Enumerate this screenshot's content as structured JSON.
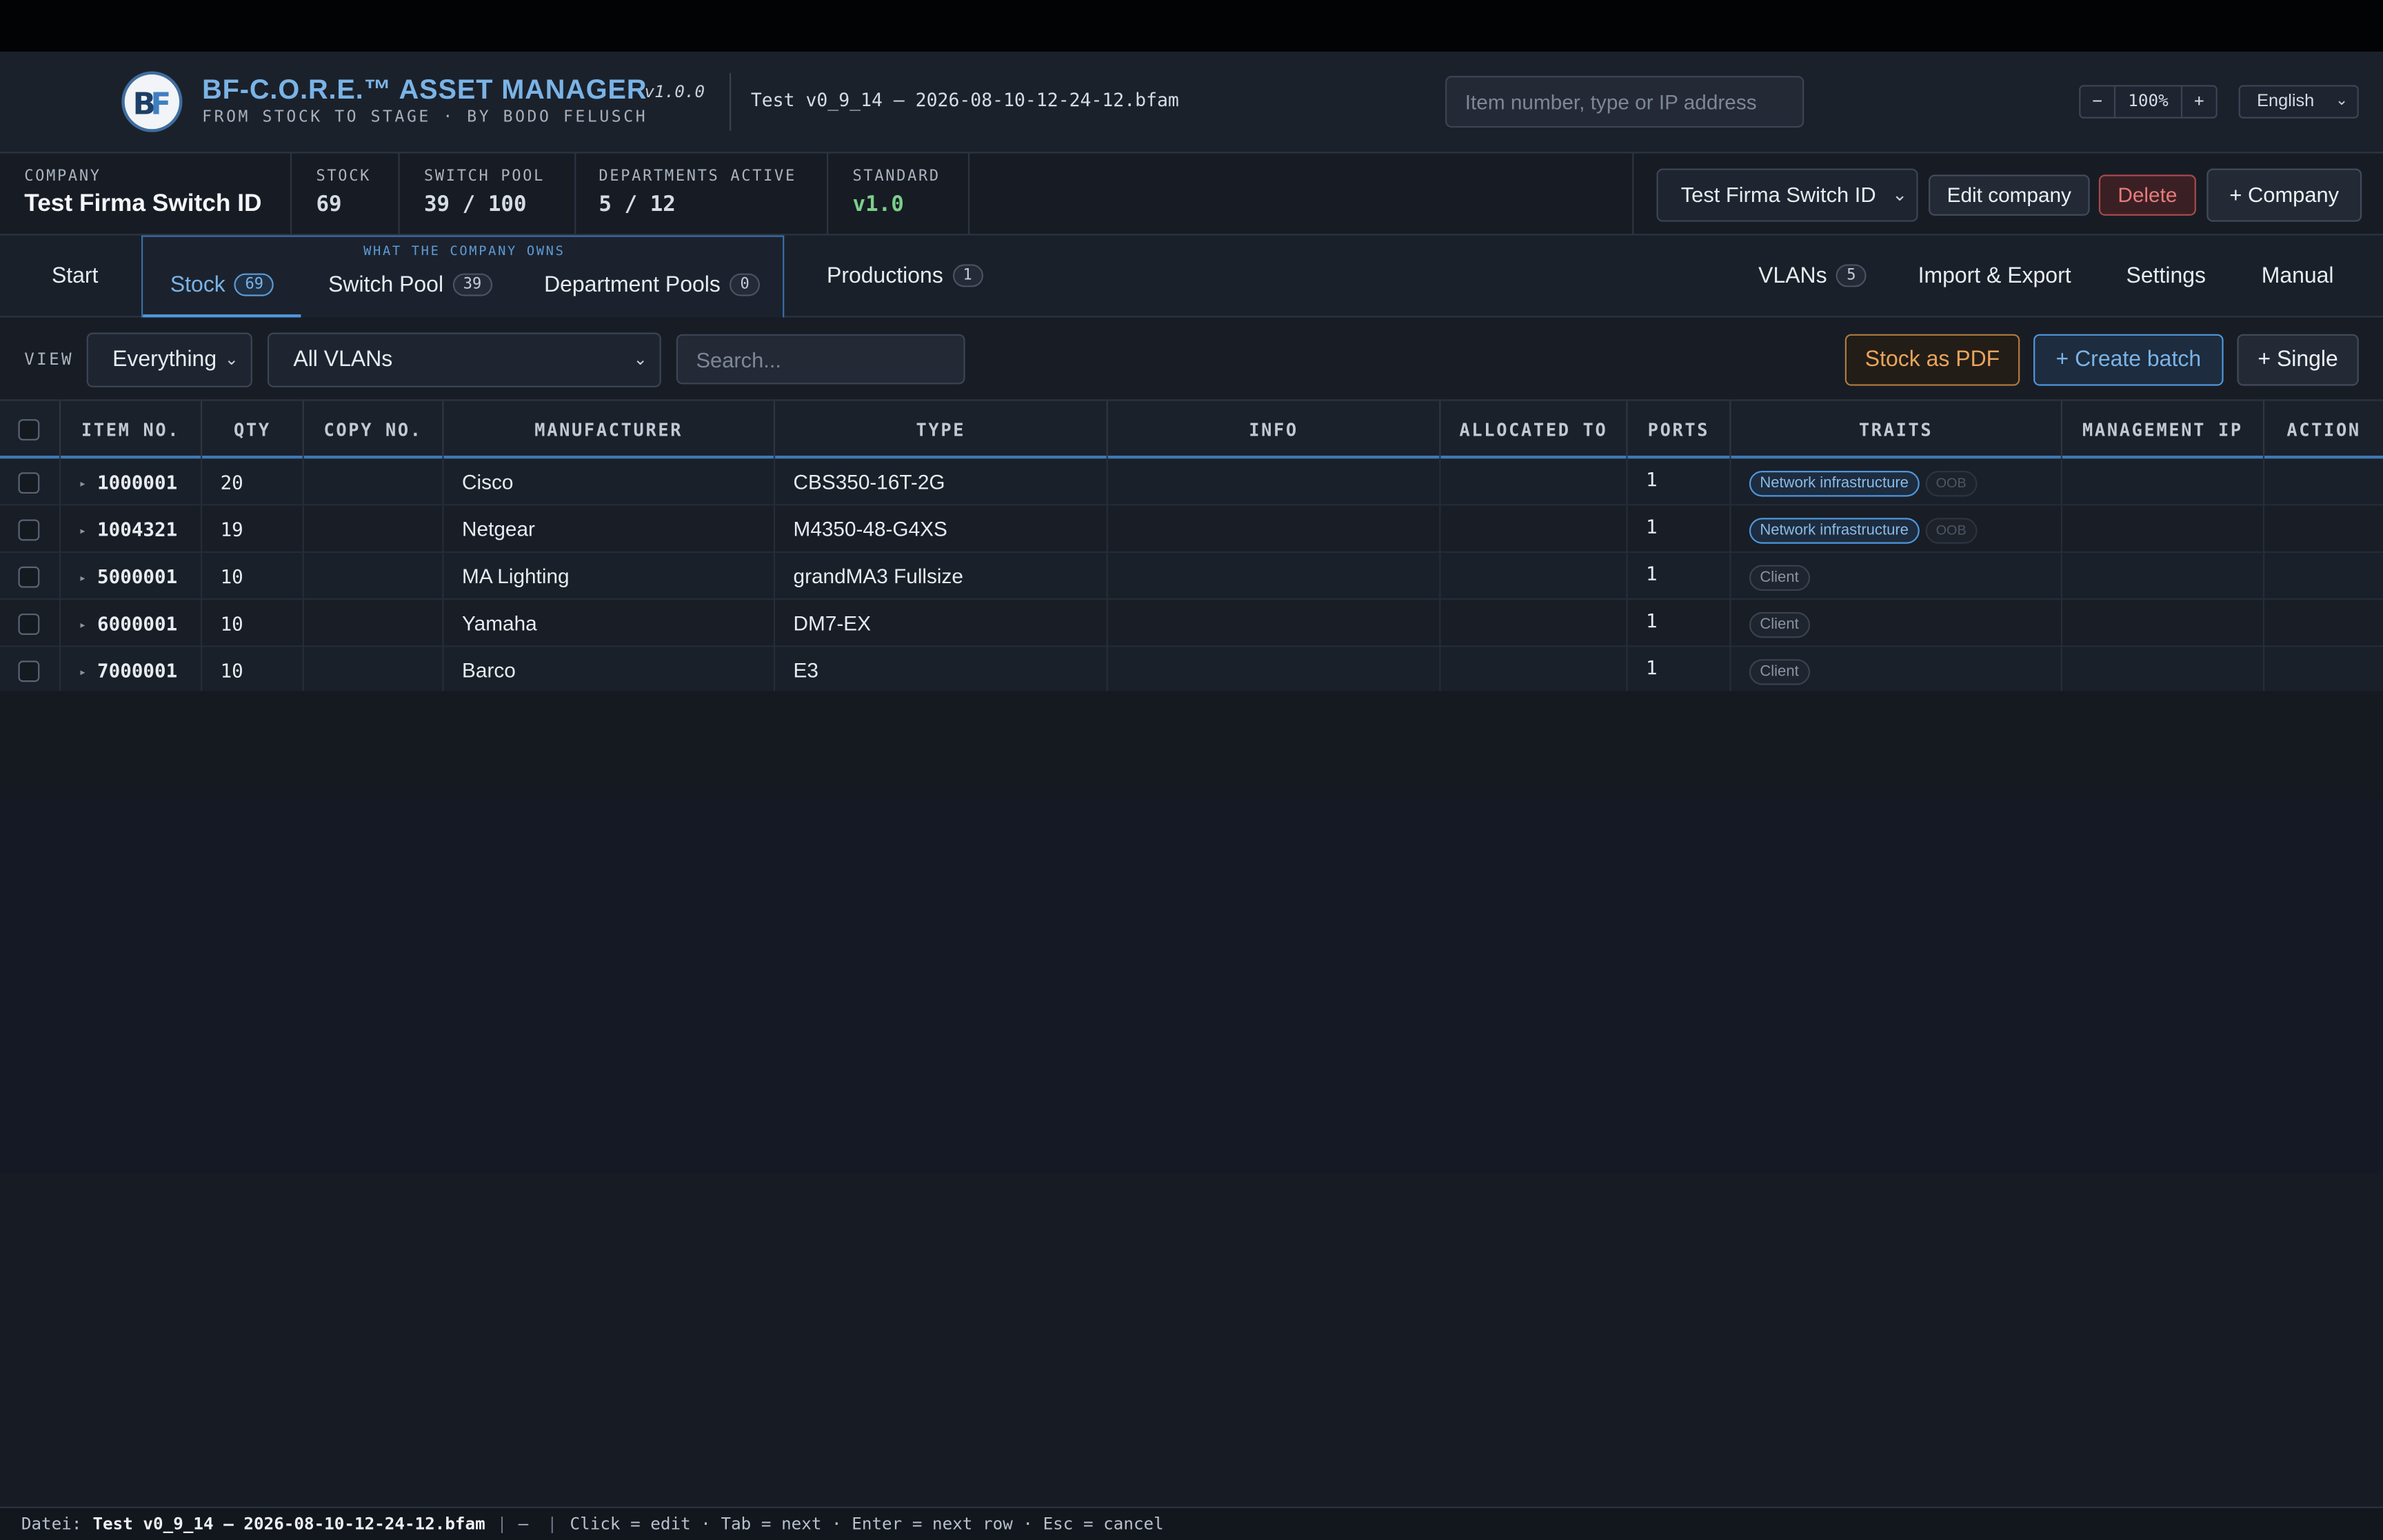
{
  "app": {
    "title": "BF-C.O.R.E.™ ASSET MANAGER",
    "version": "v1.0.0",
    "subtitle": "FROM STOCK TO STAGE · BY BODO FELUSCH",
    "file": "Test v0_9_14 – 2026-08-10-12-24-12.bfam"
  },
  "header": {
    "search_placeholder": "Item number, type or IP address",
    "zoom_minus": "−",
    "zoom_value": "100%",
    "zoom_plus": "+",
    "language": "English"
  },
  "company_bar": {
    "company_label": "COMPANY",
    "company_name": "Test Firma Switch ID",
    "stock_label": "STOCK",
    "stock_value": "69",
    "switch_pool_label": "SWITCH POOL",
    "switch_pool_value": "39 / 100",
    "departments_label": "DEPARTMENTS ACTIVE",
    "departments_value": "5 / 12",
    "standard_label": "STANDARD",
    "standard_value": "v1.0",
    "company_select": "Test Firma Switch ID",
    "edit_company": "Edit company",
    "delete": "Delete",
    "add_company": "+ Company"
  },
  "nav": {
    "start": "Start",
    "group_label": "WHAT THE COMPANY OWNS",
    "stock": "Stock",
    "stock_count": "69",
    "switch_pool": "Switch Pool",
    "switch_pool_count": "39",
    "department_pools": "Department Pools",
    "department_pools_count": "0",
    "productions": "Productions",
    "productions_count": "1",
    "vlans": "VLANs",
    "vlans_count": "5",
    "import_export": "Import & Export",
    "settings": "Settings",
    "manual": "Manual"
  },
  "toolbar": {
    "view_label": "VIEW",
    "view_select": "Everything",
    "vlan_select": "All VLANs",
    "search_placeholder": "Search...",
    "stock_pdf": "Stock as PDF",
    "create_batch": "+ Create batch",
    "single": "+ Single"
  },
  "table": {
    "columns": {
      "item_no": "ITEM NO.",
      "qty": "QTY",
      "copy_no": "COPY NO.",
      "manufacturer": "MANUFACTURER",
      "type": "TYPE",
      "info": "INFO",
      "allocated_to": "ALLOCATED TO",
      "ports": "PORTS",
      "traits": "TRAITS",
      "management_ip": "MANAGEMENT IP",
      "action": "ACTION"
    },
    "rows": [
      {
        "item_no": "1000001",
        "qty": "20",
        "copy_no": "",
        "manufacturer": "Cisco",
        "type": "CBS350-16T-2G",
        "info": "",
        "allocated_to": "",
        "ports": "1",
        "trait": "Network infrastructure",
        "trait2": "OOB",
        "management_ip": "",
        "action": ""
      },
      {
        "item_no": "1004321",
        "qty": "19",
        "copy_no": "",
        "manufacturer": "Netgear",
        "type": "M4350-48-G4XS",
        "info": "",
        "allocated_to": "",
        "ports": "1",
        "trait": "Network infrastructure",
        "trait2": "OOB",
        "management_ip": "",
        "action": ""
      },
      {
        "item_no": "5000001",
        "qty": "10",
        "copy_no": "",
        "manufacturer": "MA Lighting",
        "type": "grandMA3 Fullsize",
        "info": "",
        "allocated_to": "",
        "ports": "1",
        "trait": "Client",
        "trait2": "",
        "management_ip": "",
        "action": ""
      },
      {
        "item_no": "6000001",
        "qty": "10",
        "copy_no": "",
        "manufacturer": "Yamaha",
        "type": "DM7-EX",
        "info": "",
        "allocated_to": "",
        "ports": "1",
        "trait": "Client",
        "trait2": "",
        "management_ip": "",
        "action": ""
      },
      {
        "item_no": "7000001",
        "qty": "10",
        "copy_no": "",
        "manufacturer": "Barco",
        "type": "E3",
        "info": "",
        "allocated_to": "",
        "ports": "1",
        "trait": "Client",
        "trait2": "",
        "management_ip": "",
        "action": ""
      }
    ]
  },
  "footer": {
    "file_label": "Datei:",
    "file_name": "Test v0_9_14 – 2026-08-10-12-24-12.bfam",
    "sep1": "|",
    "dash": "—",
    "sep2": "|",
    "hints": "Click = edit · Tab = next · Enter = next row · Esc = cancel"
  },
  "icons": {
    "logo": "bf-logo-icon",
    "chevron": "chevron-down-icon",
    "expander": "triangle-right-icon"
  },
  "colors": {
    "accent": "#7ab3e6",
    "danger": "#e87b7b",
    "warning": "#e9a45d",
    "success": "#7ccf8a"
  }
}
